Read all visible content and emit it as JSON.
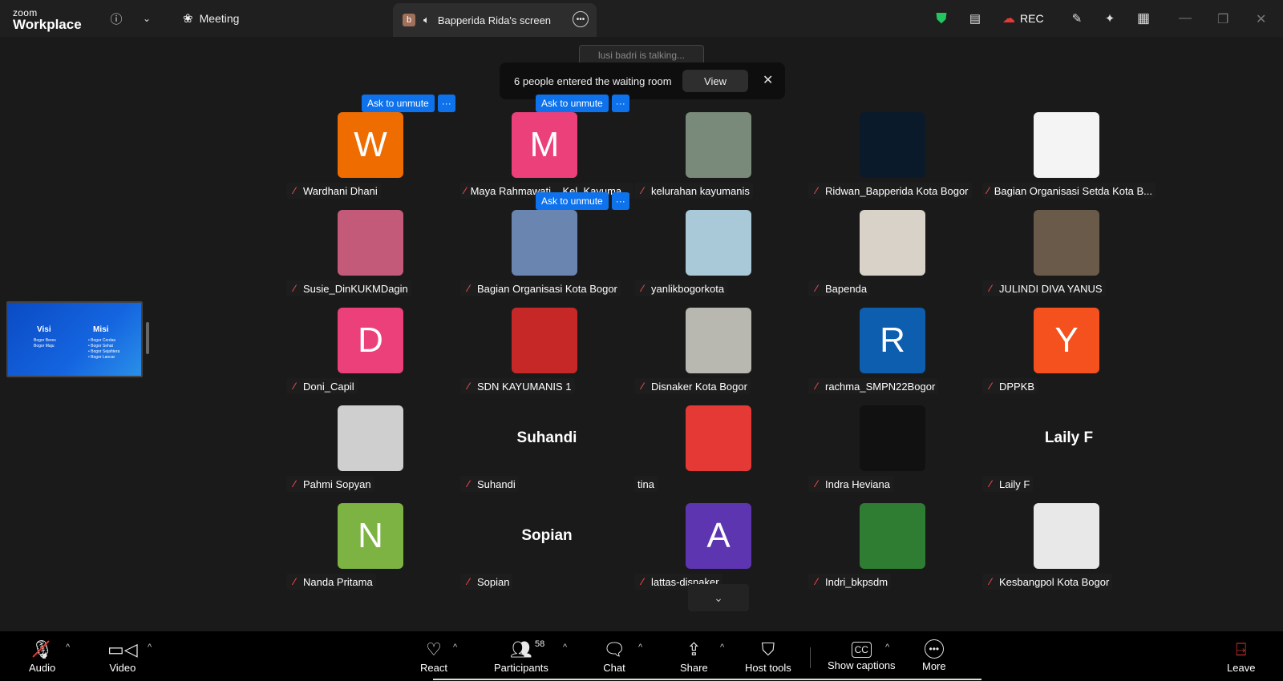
{
  "topbar": {
    "logo_top": "zoom",
    "logo_bottom": "Workplace",
    "meeting_label": "Meeting",
    "share_badge": "b",
    "share_title": "Bapperida Rida's screen",
    "rec_label": "REC"
  },
  "talking_indicator": "lusi badri is talking...",
  "notification": {
    "text": "6 people entered the waiting room",
    "view_label": "View"
  },
  "ask_unmute_label": "Ask to unmute",
  "shared_thumb": {
    "visi": "Visi",
    "misi": "Misi",
    "visi_lines": [
      "Bogor Beres",
      "Bogor Maju"
    ],
    "misi_lines": [
      "• Bogor Cerdas",
      "• Bogor Sehat",
      "• Bogor Sejahtera",
      "• Bogor Lancar"
    ]
  },
  "participants": [
    {
      "name": "Wardhani Dhani",
      "initial": "W",
      "color": "#ef6c00",
      "muted": true,
      "ask": true
    },
    {
      "name": "Maya Rahmawati _ Kel. Kayuma...",
      "initial": "M",
      "color": "#ec407a",
      "muted": true,
      "ask": true
    },
    {
      "name": "kelurahan kayumanis",
      "initial": "",
      "color": "#7a8a7a",
      "muted": true,
      "ask": false
    },
    {
      "name": "Ridwan_Bapperida Kota Bogor",
      "initial": "",
      "color": "#0b1a2a",
      "muted": true,
      "ask": false
    },
    {
      "name": "Bagian Organisasi Setda Kota B...",
      "initial": "",
      "color": "#f4f4f4",
      "muted": true,
      "ask": false
    },
    {
      "name": "Susie_DinKUKMDagin",
      "initial": "",
      "color": "#c45a7a",
      "muted": true,
      "ask": false
    },
    {
      "name": "Bagian Organisasi Kota Bogor",
      "initial": "",
      "color": "#6a86b0",
      "muted": true,
      "ask": true
    },
    {
      "name": "yanlikbogorkota",
      "initial": "",
      "color": "#a9c8d8",
      "muted": true,
      "ask": false
    },
    {
      "name": "Bapenda",
      "initial": "",
      "color": "#d8d2c8",
      "muted": true,
      "ask": false
    },
    {
      "name": "JULINDI DIVA YANUS",
      "initial": "",
      "color": "#6a5a4a",
      "muted": true,
      "ask": false
    },
    {
      "name": "Doni_Capil",
      "initial": "D",
      "color": "#ec407a",
      "muted": true,
      "ask": false
    },
    {
      "name": "SDN KAYUMANIS 1",
      "initial": "",
      "color": "#c62828",
      "muted": true,
      "ask": false
    },
    {
      "name": "Disnaker Kota Bogor",
      "initial": "",
      "color": "#b8b8b0",
      "muted": true,
      "ask": false
    },
    {
      "name": "rachma_SMPN22Bogor",
      "initial": "R",
      "color": "#0d5eaf",
      "muted": true,
      "ask": false
    },
    {
      "name": "DPPKB",
      "initial": "Y",
      "color": "#f4511e",
      "muted": true,
      "ask": false
    },
    {
      "name": "Pahmi Sopyan",
      "initial": "",
      "color": "#cfcfcf",
      "muted": true,
      "ask": false
    },
    {
      "name": "Suhandi",
      "initial": "",
      "color": "",
      "muted": true,
      "ask": false,
      "text_only": "Suhandi"
    },
    {
      "name": "tina",
      "initial": "",
      "color": "#e53935",
      "muted": false,
      "ask": false
    },
    {
      "name": "Indra Heviana",
      "initial": "",
      "color": "#111111",
      "muted": true,
      "ask": false
    },
    {
      "name": "Laily F",
      "initial": "",
      "color": "",
      "muted": true,
      "ask": false,
      "text_only": "Laily F"
    },
    {
      "name": "Nanda Pritama",
      "initial": "N",
      "color": "#7cb342",
      "muted": true,
      "ask": false
    },
    {
      "name": "Sopian",
      "initial": "",
      "color": "",
      "muted": true,
      "ask": false,
      "text_only": "Sopian"
    },
    {
      "name": "lattas-disnaker",
      "initial": "A",
      "color": "#5e35b1",
      "muted": true,
      "ask": false
    },
    {
      "name": "Indri_bkpsdm",
      "initial": "",
      "color": "#2e7d32",
      "muted": true,
      "ask": false
    },
    {
      "name": "Kesbangpol Kota Bogor",
      "initial": "",
      "color": "#e8e8e8",
      "muted": true,
      "ask": false
    }
  ],
  "toolbar": {
    "audio": "Audio",
    "video": "Video",
    "react": "React",
    "participants": "Participants",
    "participants_count": "58",
    "chat": "Chat",
    "share": "Share",
    "host_tools": "Host tools",
    "show_captions": "Show captions",
    "more": "More",
    "leave": "Leave"
  }
}
